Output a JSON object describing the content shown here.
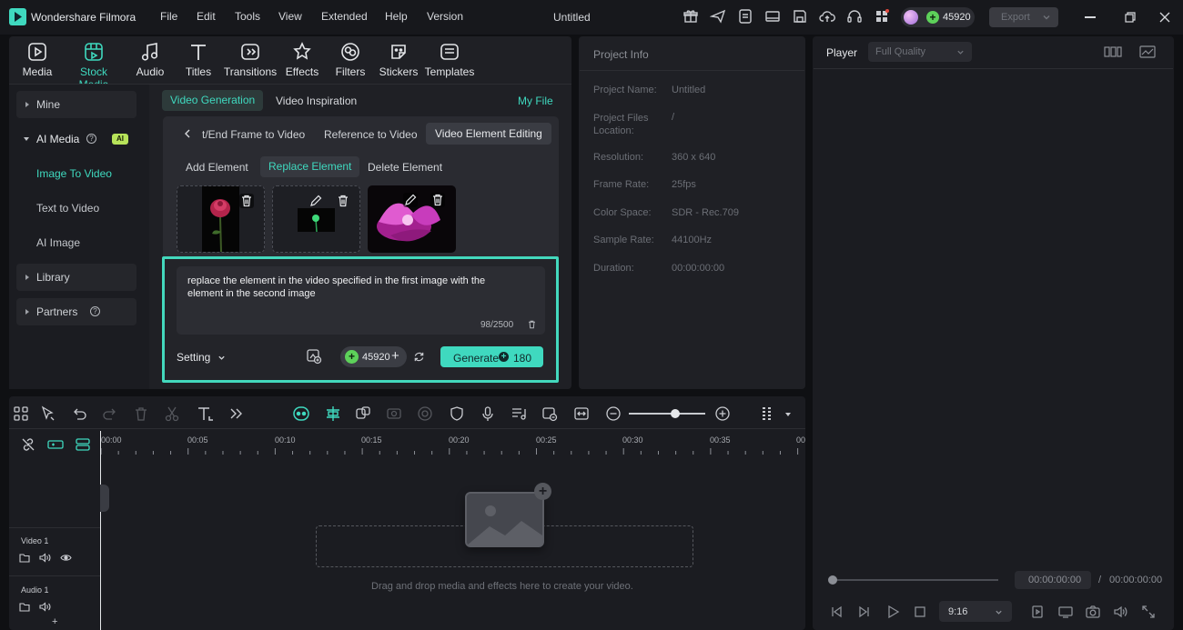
{
  "app": {
    "name": "Wondershare Filmora",
    "doc_title": "Untitled",
    "credits": "45920",
    "export_label": "Export"
  },
  "menu": [
    "File",
    "Edit",
    "Tools",
    "View",
    "Extended",
    "Help",
    "Version"
  ],
  "toolbar": {
    "tabs": [
      {
        "label": "Media",
        "icon": "media-icon"
      },
      {
        "label": "Stock Media",
        "icon": "stock-media-icon"
      },
      {
        "label": "Audio",
        "icon": "audio-icon"
      },
      {
        "label": "Titles",
        "icon": "titles-icon"
      },
      {
        "label": "Transitions",
        "icon": "transitions-icon"
      },
      {
        "label": "Effects",
        "icon": "effects-icon"
      },
      {
        "label": "Filters",
        "icon": "filters-icon"
      },
      {
        "label": "Stickers",
        "icon": "stickers-icon"
      },
      {
        "label": "Templates",
        "icon": "templates-icon"
      }
    ]
  },
  "sidebar": {
    "mine": "Mine",
    "ai_media": "AI Media",
    "ai_badge": "AI",
    "sub_items": [
      "Image To Video",
      "Text to Video",
      "AI Image"
    ],
    "library": "Library",
    "partners": "Partners"
  },
  "generation": {
    "tabs": [
      "Video Generation",
      "Video Inspiration"
    ],
    "my_file": "My File",
    "mode_tabs": [
      "t/End Frame to Video",
      "Reference to Video",
      "Video Element Editing"
    ],
    "edit_tabs": [
      "Add Element",
      "Replace Element",
      "Delete Element"
    ],
    "prompt": "replace the element in the video specified in the first image with the element in the second image",
    "char_count": "98/2500",
    "setting_label": "Setting",
    "credit_value": "45920",
    "generate_label": "Generate",
    "generate_cost": "180"
  },
  "project_info": {
    "title": "Project Info",
    "rows": [
      {
        "label": "Project Name:",
        "value": "Untitled"
      },
      {
        "label": "Project Files Location:",
        "value": "/"
      },
      {
        "label": "Resolution:",
        "value": "360 x 640"
      },
      {
        "label": "Frame Rate:",
        "value": "25fps"
      },
      {
        "label": "Color Space:",
        "value": "SDR - Rec.709"
      },
      {
        "label": "Sample Rate:",
        "value": "44100Hz"
      },
      {
        "label": "Duration:",
        "value": "00:00:00:00"
      }
    ]
  },
  "player": {
    "label": "Player",
    "quality": "Full Quality",
    "current_time": "00:00:00:00",
    "separator": "/",
    "total_time": "00:00:00:00",
    "ratio": "9:16"
  },
  "timeline": {
    "ticks": [
      "00:00",
      "00:05",
      "00:10",
      "00:15",
      "00:20",
      "00:25",
      "00:30",
      "00:35",
      "00"
    ],
    "video_track": "Video 1",
    "audio_track": "Audio 1",
    "drop_hint": "Drag and drop media and effects here to create your video."
  },
  "colors": {
    "accent": "#3fd9bf",
    "highlight_border": "#43d8bd",
    "generate_bg": "#3fd9bf"
  }
}
